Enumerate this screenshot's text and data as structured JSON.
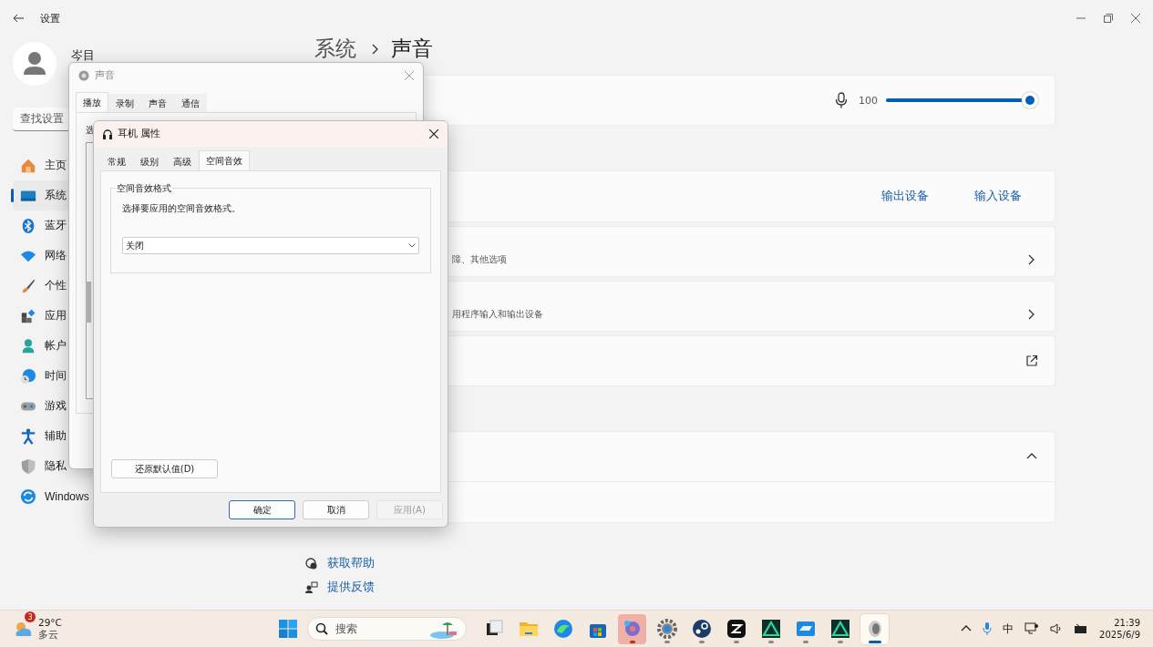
{
  "settings": {
    "title": "设置",
    "user": {
      "name": "岑目"
    },
    "search": {
      "placeholder": "查找设置"
    },
    "breadcrumb": [
      "系统",
      "声音"
    ],
    "nav": [
      {
        "label": "主页",
        "selected": false
      },
      {
        "label": "系统",
        "selected": true
      },
      {
        "label": "蓝牙",
        "selected": false
      },
      {
        "label": "网络",
        "selected": false
      },
      {
        "label": "个性",
        "selected": false
      },
      {
        "label": "应用",
        "selected": false
      },
      {
        "label": "帐户",
        "selected": false
      },
      {
        "label": "时间",
        "selected": false
      },
      {
        "label": "游戏",
        "selected": false
      },
      {
        "label": "辅助",
        "selected": false
      },
      {
        "label": "隐私",
        "selected": false
      },
      {
        "label": "Windows",
        "selected": false
      }
    ],
    "volume": {
      "value": "100",
      "level": 1
    },
    "device_links": [
      "输出设备",
      "输入设备"
    ],
    "cards": [
      {
        "kind": "link",
        "subtitle": "障、其他选项"
      },
      {
        "kind": "link",
        "subtitle": "用程序输入和输出设备"
      },
      {
        "kind": "external"
      },
      {
        "kind": "group",
        "expanded": true
      }
    ],
    "help": [
      "获取帮助",
      "提供反馈"
    ]
  },
  "sound_dialog": {
    "title": "声音",
    "tabs": [
      {
        "label": "播放",
        "selected": true
      },
      {
        "label": "录制",
        "selected": false
      },
      {
        "label": "声音",
        "selected": false
      },
      {
        "label": "通信",
        "selected": false
      }
    ],
    "content_text": "选"
  },
  "properties_dialog": {
    "title": "耳机 属性",
    "tabs": [
      {
        "label": "常规",
        "selected": false
      },
      {
        "label": "级别",
        "selected": false
      },
      {
        "label": "高级",
        "selected": false
      },
      {
        "label": "空间音效",
        "selected": true
      }
    ],
    "group_title": "空间音效格式",
    "instruction": "选择要应用的空间音效格式。",
    "format": {
      "value": "关闭"
    },
    "restore_button": "还原默认值(D)",
    "buttons": [
      {
        "label": "确定",
        "default": true,
        "disabled": false
      },
      {
        "label": "取消",
        "default": false,
        "disabled": false
      },
      {
        "label": "应用(A)",
        "default": false,
        "disabled": true
      }
    ]
  },
  "taskbar": {
    "weather": {
      "badge": "3",
      "temperature": "29°C",
      "condition": "多云"
    },
    "search": {
      "placeholder": "搜索"
    },
    "apps": [
      {
        "running": false,
        "attention": false,
        "selected": false
      },
      {
        "running": false,
        "attention": false,
        "selected": false
      },
      {
        "running": false,
        "attention": false,
        "selected": false
      },
      {
        "running": false,
        "attention": false,
        "selected": false
      },
      {
        "running": true,
        "attention": true,
        "selected": false
      },
      {
        "running": true,
        "attention": false,
        "selected": false
      },
      {
        "running": true,
        "attention": false,
        "selected": false
      },
      {
        "running": true,
        "attention": false,
        "selected": false
      },
      {
        "running": true,
        "attention": false,
        "selected": false
      },
      {
        "running": true,
        "attention": false,
        "selected": false
      },
      {
        "running": true,
        "attention": false,
        "selected": false
      },
      {
        "running": true,
        "attention": false,
        "selected": true
      }
    ],
    "input_method": "中",
    "time": "21:39",
    "date": "2025/6/9"
  }
}
